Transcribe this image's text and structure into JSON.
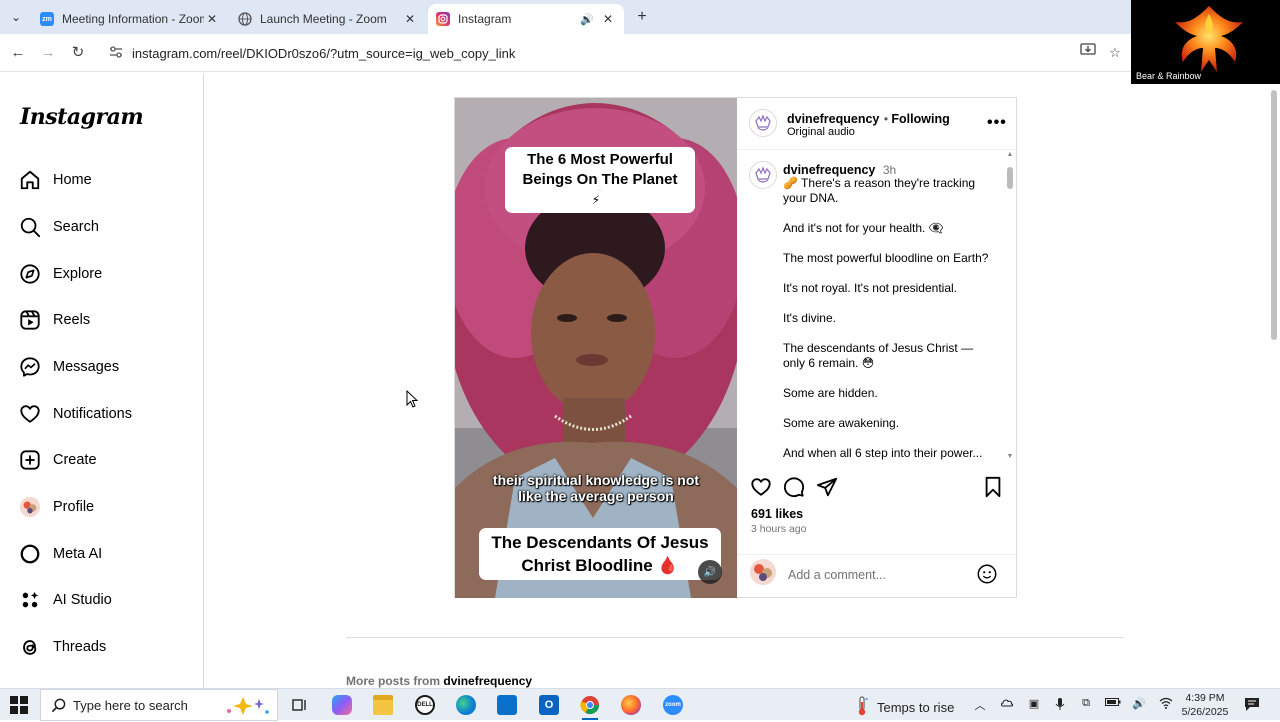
{
  "browser": {
    "tabs": [
      {
        "title": "Meeting Information - Zoom",
        "favicon": "zoom",
        "active": false
      },
      {
        "title": "Launch Meeting - Zoom",
        "favicon": "globe",
        "active": false
      },
      {
        "title": "Instagram",
        "favicon": "instagram",
        "active": true
      }
    ],
    "url": "instagram.com/reel/DKIODr0szo6/?utm_source=ig_web_copy_link"
  },
  "zoom_overlay": {
    "participant_name": "Bear & Rainbow"
  },
  "sidebar": {
    "logo": "Instagram",
    "items": [
      {
        "label": "Home",
        "icon": "home-icon"
      },
      {
        "label": "Search",
        "icon": "search-icon"
      },
      {
        "label": "Explore",
        "icon": "compass-icon"
      },
      {
        "label": "Reels",
        "icon": "reels-icon"
      },
      {
        "label": "Messages",
        "icon": "messenger-icon"
      },
      {
        "label": "Notifications",
        "icon": "heart-icon"
      },
      {
        "label": "Create",
        "icon": "plus-square-icon"
      },
      {
        "label": "Profile",
        "icon": "avatar"
      },
      {
        "label": "Meta AI",
        "icon": "meta-ai-icon"
      },
      {
        "label": "AI Studio",
        "icon": "ai-studio-icon"
      },
      {
        "label": "Threads",
        "icon": "threads-icon"
      }
    ]
  },
  "post": {
    "video": {
      "top_text": "The 6 Most Powerful Beings On The Planet 🌍",
      "top_emoji": "⚡",
      "subtitle": "their spiritual knowledge is not like the average person",
      "bottom_text": "The Descendants Of Jesus Christ Bloodline 🩸"
    },
    "author": "dvinefrequency",
    "follow_state": "Following",
    "audio": "Original audio",
    "caption_time": "3h",
    "caption_lines": [
      "🥜 There's a reason they're tracking your DNA.",
      "And it's not for your health. 👁‍🗨",
      "The most powerful bloodline on Earth?",
      "It's not royal. It's not presidential.",
      "It's divine.",
      "The descendants of Jesus Christ — only 6 remain. 😳",
      "Some are hidden.",
      "Some are awakening.",
      "And when all 6 step into their power..."
    ],
    "likes": "691 likes",
    "time_ago": "3 hours ago",
    "comment_placeholder": "Add a comment...",
    "more_posts_prefix": "More posts from",
    "more_posts_user": "dvinefrequency"
  },
  "taskbar": {
    "search_placeholder": "Type here to search",
    "weather_text": "Temps to rise",
    "time": "4:39 PM",
    "date": "5/26/2025"
  },
  "colors": {
    "tabbar_bg": "#dfe7f5",
    "taskbar_bg": "#e9eef5",
    "ig_border": "#dbdbdb",
    "muted": "#737373",
    "hair_magenta": "#b03a6e"
  }
}
